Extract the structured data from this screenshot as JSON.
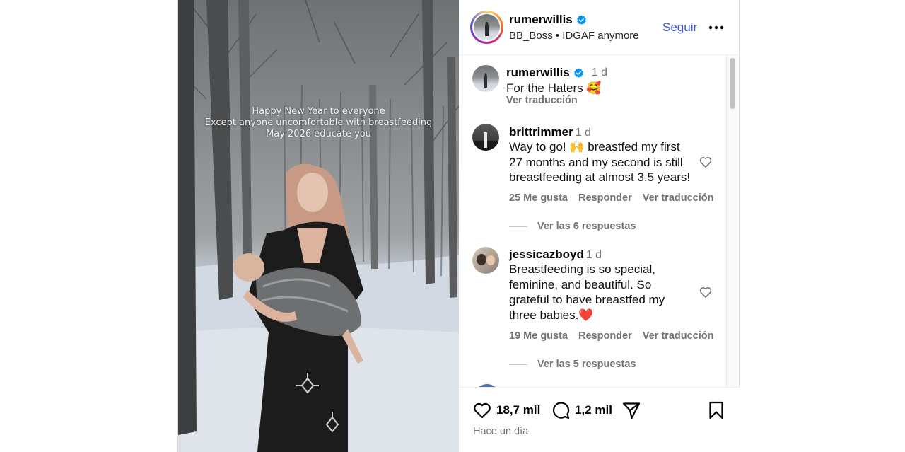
{
  "media": {
    "overlay_lines": [
      "Happy New Year to everyone",
      "Except anyone uncomfortable with breastfeeding",
      "May 2026 educate you"
    ]
  },
  "header": {
    "username": "rumerwillis",
    "subtitle": "BB_Boss • IDGAF anymore",
    "follow_label": "Seguir",
    "more_icon": "more-horizontal-icon"
  },
  "caption": {
    "username": "rumerwillis",
    "time": "1 d",
    "text": "For the Haters 🥰",
    "translate_label": "Ver traducción"
  },
  "comments": [
    {
      "username": "brittrimmer",
      "time": "1 d",
      "lines": [
        "Way to go! 🙌 breastfed my first",
        "27 months and my second is still",
        "breastfeeding at almost 3.5 years!"
      ],
      "likes": "25 Me gusta",
      "reply_label": "Responder",
      "translate_label": "Ver traducción",
      "replies_label": "Ver las 6 respuestas"
    },
    {
      "username": "jessicazboyd",
      "time": "1 d",
      "lines": [
        "Breastfeeding is so special,",
        "feminine, and beautiful. So",
        "grateful to have breastfed my",
        "three babies.❤️"
      ],
      "likes": "19 Me gusta",
      "reply_label": "Responder",
      "translate_label": "Ver traducción",
      "replies_label": "Ver las 5 respuestas"
    }
  ],
  "footer": {
    "like_count": "18,7 mil",
    "comment_count": "1,2 mil",
    "posted_time": "Hace un día"
  },
  "colors": {
    "link_blue": "#3a5ad9",
    "verified_blue": "#0095f6",
    "secondary_text": "#737373"
  }
}
